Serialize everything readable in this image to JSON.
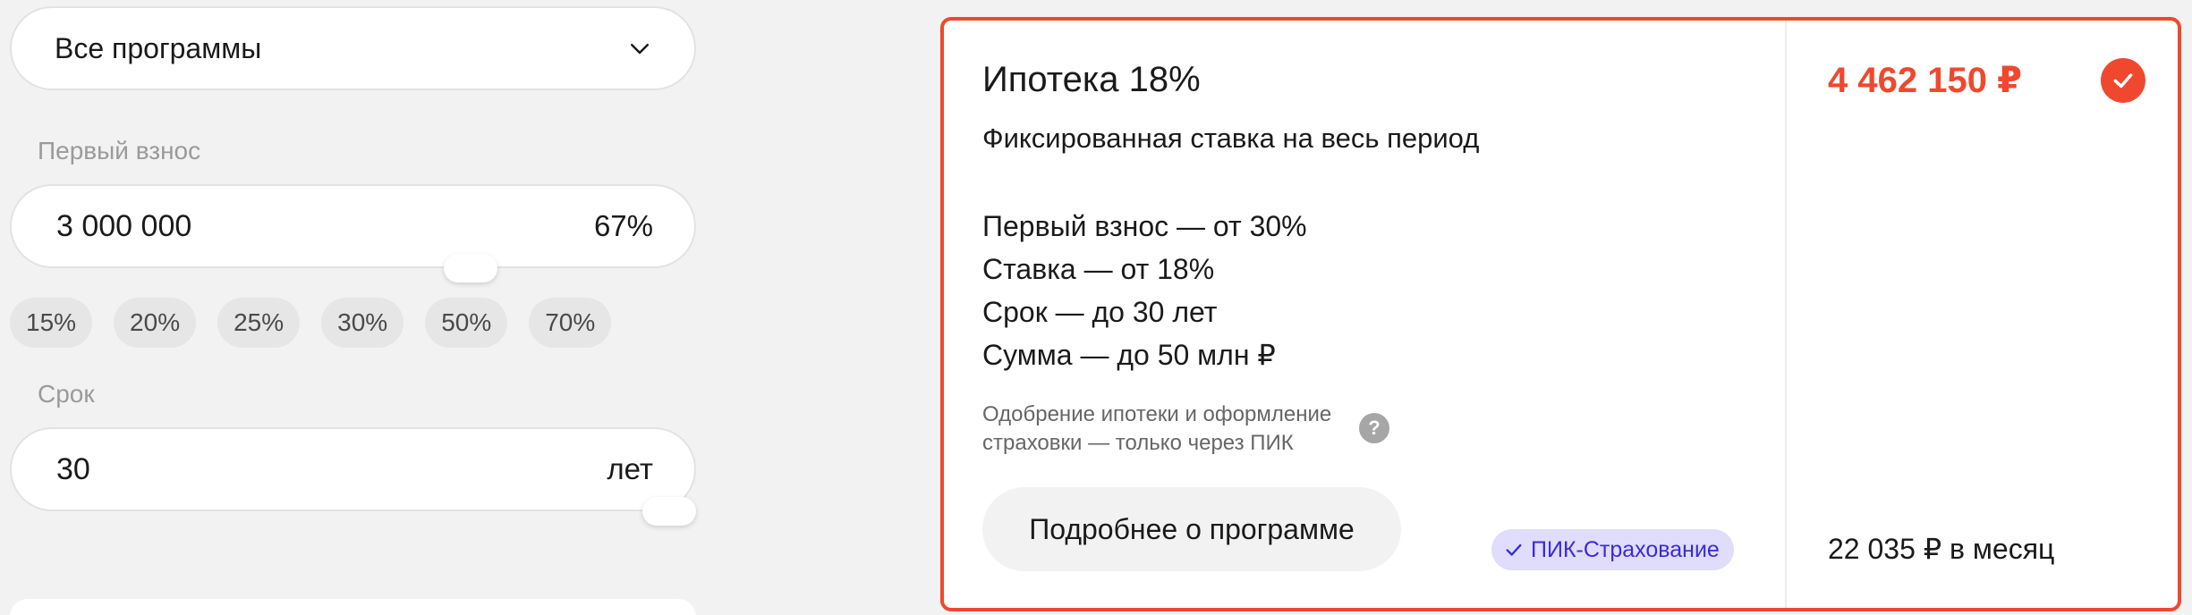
{
  "filters": {
    "program_select": {
      "value": "Все программы",
      "icon": "chevron-down-icon"
    },
    "down_payment": {
      "label": "Первый взнос",
      "value": "3 000 000",
      "percent": "67%",
      "chips": [
        "15%",
        "20%",
        "25%",
        "30%",
        "50%",
        "70%"
      ]
    },
    "term": {
      "label": "Срок",
      "value": "30",
      "unit": "лет"
    }
  },
  "program": {
    "title": "Ипотека 18%",
    "subtitle": "Фиксированная ставка на весь период",
    "conditions": [
      "Первый взнос — от 30%",
      "Ставка — от 18%",
      "Срок — до 30 лет",
      "Сумма — до 50 млн ₽"
    ],
    "note": "Одобрение ипотеки и оформление страховки — только через ПИК",
    "help_icon": "?",
    "details_button": "Подробнее о программе",
    "badge": "ПИК-Страхование",
    "price": "4 462 150 ₽",
    "monthly": "22 035 ₽ в месяц",
    "selected": true
  },
  "colors": {
    "accent": "#f0482e",
    "badge_bg": "#e0dcfb",
    "badge_text": "#3a2bd6"
  }
}
